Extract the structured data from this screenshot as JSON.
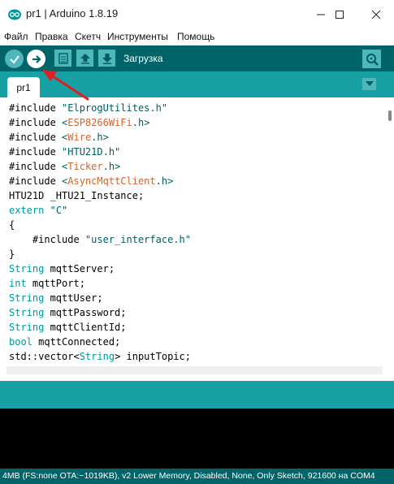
{
  "window": {
    "title": "pr1 | Arduino 1.8.19",
    "app_icon": "arduino-logo-icon",
    "controls": [
      "minimize-icon",
      "maximize-icon",
      "close-icon"
    ]
  },
  "menu": [
    "Файл",
    "Правка",
    "Скетч",
    "Инструменты",
    "Помощь"
  ],
  "toolbar": {
    "buttons": [
      "verify-check-icon",
      "upload-arrow-icon",
      "new-file-icon",
      "open-upload-icon",
      "save-download-icon"
    ],
    "status": "Загрузка",
    "monitor_icon": "serial-monitor-icon"
  },
  "tabs": [
    {
      "label": "pr1"
    }
  ],
  "tab_menu_icon": "tab-menu-triangle-icon",
  "colors": {
    "toolbar_bg": "#006468",
    "tabbar_bg": "#17a1a5",
    "button_bg": "#4db7bb",
    "keyword": "#cc6633",
    "type": "#00979c",
    "string": "#005c5f",
    "arrow": "#e02020"
  },
  "code_lines": [
    [
      {
        "t": "#include ",
        "c": "plain"
      },
      {
        "t": "\"ElprogUtilites.h\"",
        "c": "str"
      }
    ],
    [
      {
        "t": "#include ",
        "c": "plain"
      },
      {
        "t": "<",
        "c": "str"
      },
      {
        "t": "ESP8266WiFi",
        "c": "kw"
      },
      {
        "t": ".h>",
        "c": "str"
      }
    ],
    [
      {
        "t": "#include ",
        "c": "plain"
      },
      {
        "t": "<",
        "c": "str"
      },
      {
        "t": "Wire",
        "c": "kw"
      },
      {
        "t": ".h>",
        "c": "str"
      }
    ],
    [
      {
        "t": "#include ",
        "c": "plain"
      },
      {
        "t": "\"HTU21D.h\"",
        "c": "str"
      }
    ],
    [
      {
        "t": "#include ",
        "c": "plain"
      },
      {
        "t": "<",
        "c": "str"
      },
      {
        "t": "Ticker",
        "c": "kw"
      },
      {
        "t": ".h>",
        "c": "str"
      }
    ],
    [
      {
        "t": "#include ",
        "c": "plain"
      },
      {
        "t": "<",
        "c": "str"
      },
      {
        "t": "AsyncMqttClient",
        "c": "kw"
      },
      {
        "t": ".h>",
        "c": "str"
      }
    ],
    [
      {
        "t": "HTU21D _HTU21_Instance;",
        "c": "plain"
      }
    ],
    [
      {
        "t": "extern",
        "c": "type"
      },
      {
        "t": " ",
        "c": "plain"
      },
      {
        "t": "\"C\"",
        "c": "str"
      }
    ],
    [
      {
        "t": "{",
        "c": "plain"
      }
    ],
    [
      {
        "t": "    #include ",
        "c": "plain"
      },
      {
        "t": "\"user_interface.h\"",
        "c": "str"
      }
    ],
    [
      {
        "t": "}",
        "c": "plain"
      }
    ],
    [
      {
        "t": "String",
        "c": "type"
      },
      {
        "t": " mqttServer;",
        "c": "plain"
      }
    ],
    [
      {
        "t": "int",
        "c": "type"
      },
      {
        "t": " mqttPort;",
        "c": "plain"
      }
    ],
    [
      {
        "t": "String",
        "c": "type"
      },
      {
        "t": " mqttUser;",
        "c": "plain"
      }
    ],
    [
      {
        "t": "String",
        "c": "type"
      },
      {
        "t": " mqttPassword;",
        "c": "plain"
      }
    ],
    [
      {
        "t": "String",
        "c": "type"
      },
      {
        "t": " mqttClientId;",
        "c": "plain"
      }
    ],
    [
      {
        "t": "bool",
        "c": "type"
      },
      {
        "t": " mqttConnected;",
        "c": "plain"
      }
    ],
    [
      {
        "t": "std::vector<",
        "c": "plain"
      },
      {
        "t": "String",
        "c": "type"
      },
      {
        "t": "> inputTopic;",
        "c": "plain"
      }
    ]
  ],
  "footer": "4MB (FS:none OTA:~1019KB), v2 Lower Memory, Disabled, None, Only Sketch, 921600 на COM4"
}
